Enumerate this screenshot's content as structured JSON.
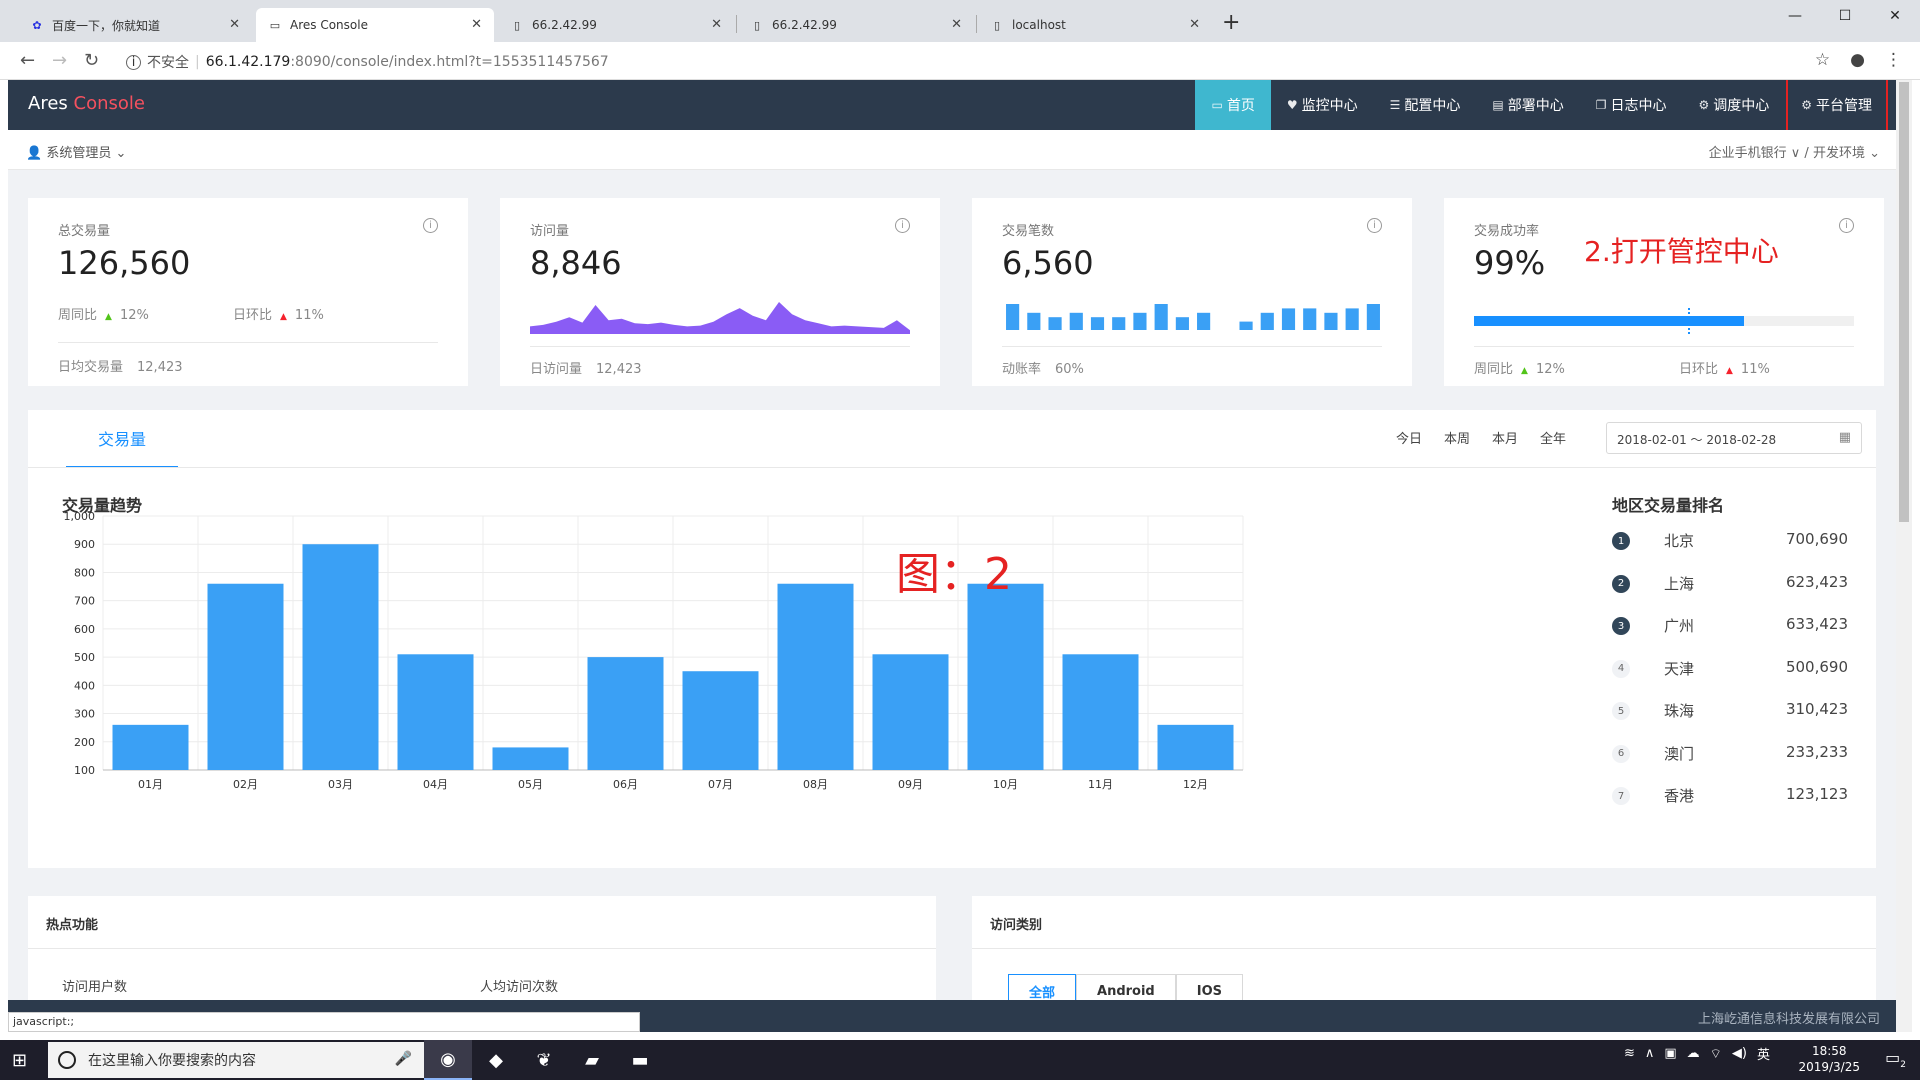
{
  "browser": {
    "tabs": [
      {
        "title": "百度一下，你就知道",
        "icon": "baidu-paw-icon"
      },
      {
        "title": "Ares Console",
        "icon": "page-icon"
      },
      {
        "title": "66.2.42.99",
        "icon": "page-icon"
      },
      {
        "title": "66.2.42.99",
        "icon": "page-icon"
      },
      {
        "title": "localhost",
        "icon": "page-icon"
      }
    ],
    "active_tab": 1,
    "url_insecure": "不安全",
    "url_host": "66.1.42.179",
    "url_rest": ":8090/console/index.html?t=1553511457567"
  },
  "app": {
    "brand_main": "Ares",
    "brand_accent": "Console",
    "accent_color": "#f5515f",
    "nav_color": "#2c3a4c",
    "active_nav_color": "#3fb7cf",
    "menu": [
      {
        "label": "首页",
        "icon": "monitor-icon"
      },
      {
        "label": "监控中心",
        "icon": "heart-icon"
      },
      {
        "label": "配置中心",
        "icon": "sliders-icon"
      },
      {
        "label": "部署中心",
        "icon": "server-icon"
      },
      {
        "label": "日志中心",
        "icon": "log-icon"
      },
      {
        "label": "调度中心",
        "icon": "gear-icon"
      },
      {
        "label": "平台管理",
        "icon": "gear-icon"
      }
    ],
    "user": "系统管理员",
    "env": "企业手机银行 ∨ / 开发环境"
  },
  "cards": {
    "total": {
      "title": "总交易量",
      "value": "126,560",
      "wow_label": "周同比",
      "wow": "12%",
      "dod_label": "日环比",
      "dod": "11%",
      "foot_label": "日均交易量",
      "foot_value": "12,423"
    },
    "visits": {
      "title": "访问量",
      "value": "8,846",
      "foot_label": "日访问量",
      "foot_value": "12,423"
    },
    "count": {
      "title": "交易笔数",
      "value": "6,560",
      "foot_label": "动账率",
      "foot_value": "60%"
    },
    "rate": {
      "title": "交易成功率",
      "value": "99%",
      "progress": 0.71,
      "target": 0.94,
      "wow_label": "周同比",
      "wow": "12%",
      "dod_label": "日环比",
      "dod": "11%"
    }
  },
  "annotation": "2.打开管控中心",
  "annotation2": "图：2",
  "panel": {
    "tab": "交易量",
    "ranges": [
      "今日",
      "本周",
      "本月",
      "全年"
    ],
    "date_range": "2018-02-01 ～ 2018-02-28",
    "chart_title": "交易量趋势",
    "rank_title": "地区交易量排名",
    "ranking": [
      {
        "rank": "1",
        "city": "北京",
        "value": "700,690"
      },
      {
        "rank": "2",
        "city": "上海",
        "value": "623,423"
      },
      {
        "rank": "3",
        "city": "广州",
        "value": "633,423"
      },
      {
        "rank": "4",
        "city": "天津",
        "value": "500,690"
      },
      {
        "rank": "5",
        "city": "珠海",
        "value": "310,423"
      },
      {
        "rank": "6",
        "city": "澳门",
        "value": "233,233"
      },
      {
        "rank": "7",
        "city": "香港",
        "value": "123,123"
      }
    ]
  },
  "chart_data": [
    {
      "type": "bar",
      "title": "交易量趋势",
      "categories": [
        "01月",
        "02月",
        "03月",
        "04月",
        "05月",
        "06月",
        "07月",
        "08月",
        "09月",
        "10月",
        "11月",
        "12月"
      ],
      "values": [
        260,
        760,
        900,
        510,
        180,
        500,
        450,
        760,
        510,
        760,
        510,
        260
      ],
      "ylim": [
        100,
        1000
      ],
      "yticks": [
        "100",
        "200",
        "300",
        "400",
        "500",
        "600",
        "700",
        "800",
        "900",
        "1,000"
      ],
      "grid": true,
      "color": "#3aa0f5"
    },
    {
      "type": "area",
      "values": [
        1,
        1.2,
        1.6,
        2.2,
        1.5,
        3.8,
        1.8,
        2.0,
        1.4,
        1.3,
        1.5,
        1.2,
        1.0,
        1.1,
        1.6,
        2.6,
        3.4,
        2.4,
        1.8,
        4.2,
        2.6,
        1.8,
        1.4,
        1.0,
        1.1,
        1.0,
        0.9,
        0.8,
        1.8,
        0.5
      ],
      "color": "#8a5cf5"
    },
    {
      "type": "bar",
      "values": [
        5,
        3,
        2,
        3,
        2,
        2,
        3,
        5,
        2,
        3,
        0,
        1,
        3,
        4,
        4,
        3,
        4,
        5
      ],
      "color": "#3aa0f5"
    }
  ],
  "bottom": {
    "hot_title": "热点功能",
    "hot_col1": "访问用户数",
    "hot_col2": "人均访问次数",
    "type_title": "访问类别",
    "segments": [
      "全部",
      "Android",
      "IOS"
    ]
  },
  "footer": {
    "copyright": "上海屹通信息科技发展有限公司",
    "status": "javascript:;"
  },
  "taskbar": {
    "search_placeholder": "在这里输入你要搜索的内容",
    "time": "18:58",
    "date": "2019/3/25",
    "ime": "英",
    "notif_count": "2"
  }
}
